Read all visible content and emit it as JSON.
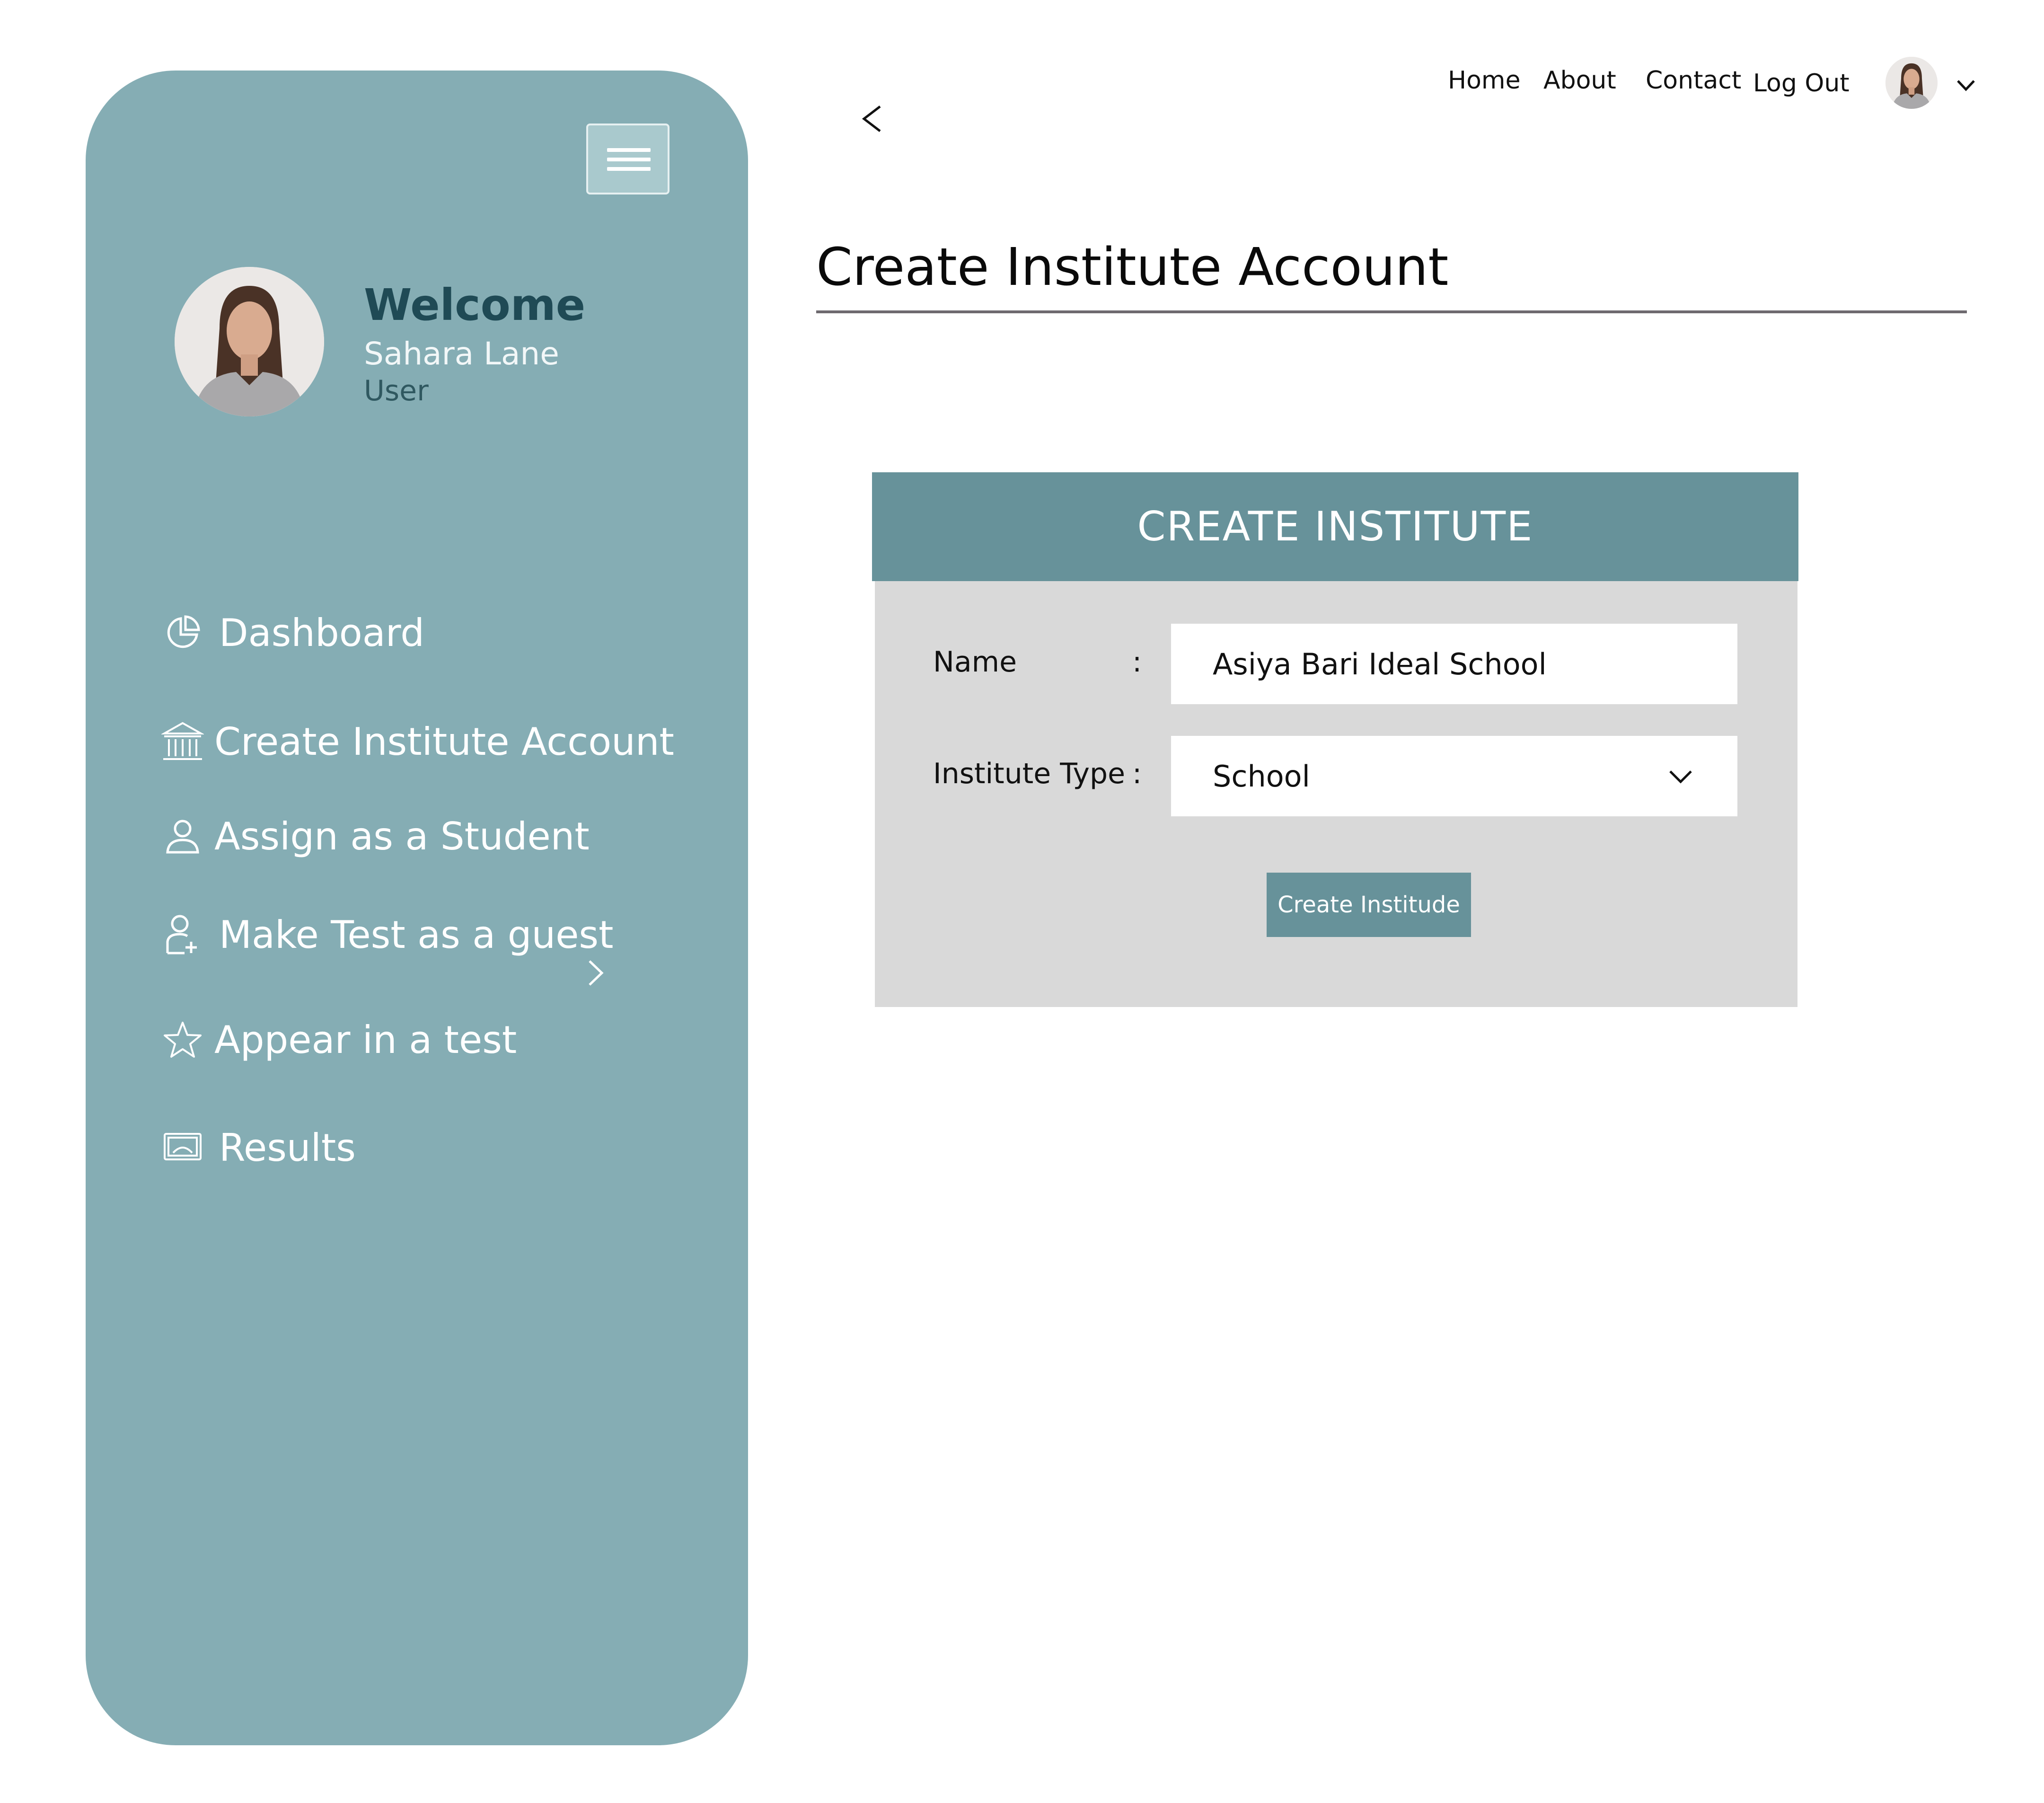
{
  "topnav": {
    "items": [
      "Home",
      "About",
      "Contact",
      "Log Out"
    ]
  },
  "sidebar": {
    "welcome": "Welcome",
    "user_name": "Sahara Lane",
    "user_role": "User",
    "items": [
      {
        "label": "Dashboard",
        "icon": "pie-chart-icon"
      },
      {
        "label": "Create Institute Account",
        "icon": "institution-icon"
      },
      {
        "label": "Assign as a Student",
        "icon": "user-icon"
      },
      {
        "label": "Make Test as a guest",
        "icon": "user-plus-icon"
      },
      {
        "label": "Appear in a test",
        "icon": "star-icon"
      },
      {
        "label": "Results",
        "icon": "monitor-icon"
      }
    ]
  },
  "page": {
    "title": "Create Institute Account"
  },
  "form": {
    "header": "CREATE INSTITUTE",
    "name_label": "Name",
    "name_value": "Asiya Bari Ideal School",
    "type_label": "Institute Type",
    "type_value": "School",
    "separator": ":",
    "submit_label": "Create Institude"
  },
  "colors": {
    "sidebar_bg": "#85adb4",
    "accent": "#67929a",
    "form_bg": "#d9d9d9",
    "welcome_text": "#1f4a55"
  }
}
